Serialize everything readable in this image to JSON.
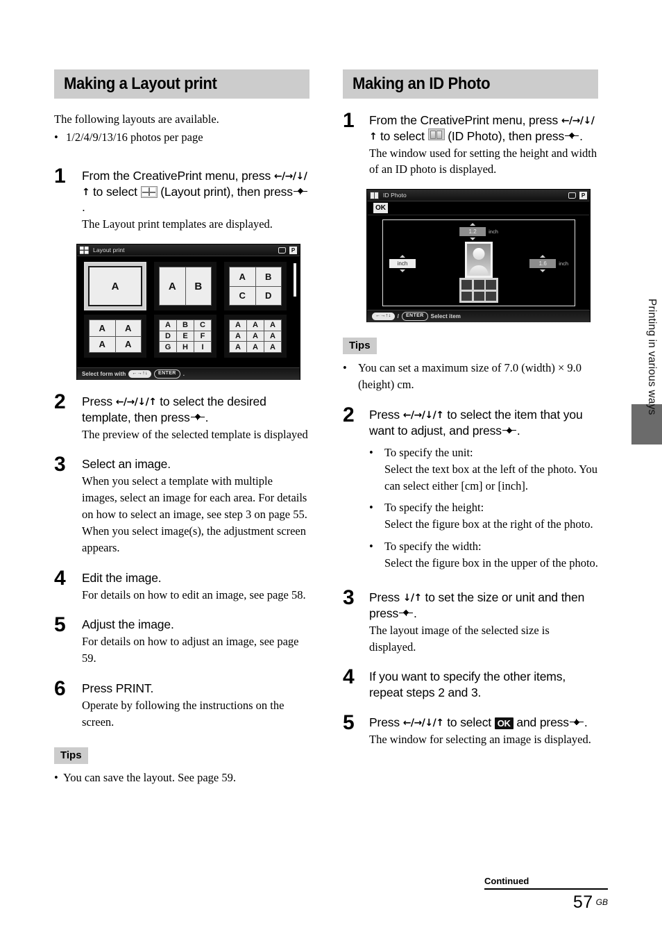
{
  "page": {
    "number": "57",
    "region_code": "GB",
    "continued_label": "Continued",
    "side_tab_label": "Printing in various ways",
    "side_tab_color": "#6b6b6b",
    "heading_band_color": "#cccccc"
  },
  "left_section": {
    "heading": "Making a Layout print",
    "intro": "The following layouts are available.",
    "intro_bullets": [
      "1/2/4/9/13/16 photos per page"
    ],
    "steps": [
      {
        "num": "1",
        "lead_a": "From the CreativePrint menu, press",
        "lead_arrows": "←/→/↓/↑",
        "lead_b": "to select",
        "icon": "layout-print-icon",
        "lead_c": "(Layout print), then press",
        "lead_d": ".",
        "sub": "The Layout print templates are displayed."
      },
      {
        "num": "2",
        "lead_a": "Press",
        "lead_arrows": "←/→/↓/↑",
        "lead_b": "to select the desired template, then press",
        "lead_d": ".",
        "sub": "The preview of the selected template is displayed"
      },
      {
        "num": "3",
        "lead_a": "Select an image.",
        "sub": "When you select a template with multiple images, select an image for each area. For details on how to select an image, see step 3 on page 55. When you select image(s), the adjustment screen appears."
      },
      {
        "num": "4",
        "lead_a": "Edit the image.",
        "sub": "For details on how to edit an image, see page 58."
      },
      {
        "num": "5",
        "lead_a": "Adjust the image.",
        "sub": "For details on how to adjust an image, see page 59."
      },
      {
        "num": "6",
        "lead_a": "Press PRINT.",
        "sub": "Operate by following the instructions on the screen."
      }
    ],
    "tips": {
      "label": "Tips",
      "items": [
        "You can save the layout. See page 59."
      ]
    },
    "screenshot": {
      "title": "Layout print",
      "title_icon": "layout-grid-icon",
      "status_icons": [
        "display-icon",
        "p-icon"
      ],
      "p_icon_label": "P",
      "bottom_hint_prefix": "Select form with",
      "bottom_hint_arrows": "←→↑↓",
      "bottom_hint_enter": "ENTER",
      "bottom_hint_suffix": ".",
      "templates": [
        {
          "name": "1-up",
          "cols": 1,
          "rows": 1,
          "labels": [
            "A"
          ],
          "selected": true,
          "size": "lg"
        },
        {
          "name": "2-up",
          "cols": 2,
          "rows": 1,
          "labels": [
            "A",
            "B"
          ],
          "selected": false,
          "size": "lg"
        },
        {
          "name": "4-up-abcd",
          "cols": 2,
          "rows": 2,
          "labels": [
            "A",
            "B",
            "C",
            "D"
          ],
          "selected": false,
          "size": "md"
        },
        {
          "name": "4-up-aaaa",
          "cols": 2,
          "rows": 2,
          "labels": [
            "A",
            "A",
            "A",
            "A"
          ],
          "selected": false,
          "size": "md"
        },
        {
          "name": "9-up-abcdefghi",
          "cols": 3,
          "rows": 3,
          "labels": [
            "A",
            "B",
            "C",
            "D",
            "E",
            "F",
            "G",
            "H",
            "I"
          ],
          "selected": false,
          "size": "sm"
        },
        {
          "name": "9-up-aaaaaaaaa",
          "cols": 3,
          "rows": 3,
          "labels": [
            "A",
            "A",
            "A",
            "A",
            "A",
            "A",
            "A",
            "A",
            "A"
          ],
          "selected": false,
          "size": "sm"
        }
      ]
    }
  },
  "right_section": {
    "heading": "Making an ID Photo",
    "steps": [
      {
        "num": "1",
        "lead_a": "From the CreativePrint menu, press",
        "lead_arrows": "←/→/↓/↑",
        "lead_b": "to select",
        "icon": "id-photo-icon",
        "lead_c": "(ID Photo), then press",
        "lead_d": ".",
        "sub": "The window used for setting the height and width of an ID photo is displayed."
      },
      {
        "num": "2",
        "lead_a": "Press",
        "lead_arrows": "←/→/↓/↑",
        "lead_b": "to select the item that you want to adjust, and press",
        "lead_d": ".",
        "bullets": [
          {
            "title": "To specify the unit:",
            "text": "Select the text box at the left of the photo. You can select either [cm] or [inch]."
          },
          {
            "title": "To specify the height:",
            "text": "Select the figure box at the right of the photo."
          },
          {
            "title": "To specify the width:",
            "text": "Select the figure box in the upper of the photo."
          }
        ]
      },
      {
        "num": "3",
        "lead_a": "Press",
        "lead_arrows": "↓/↑",
        "lead_b": "to set the size or unit and then press",
        "lead_d": ".",
        "sub": "The layout image of the selected size is displayed."
      },
      {
        "num": "4",
        "lead_a": "If you want to specify the other items, repeat steps 2 and 3."
      },
      {
        "num": "5",
        "lead_a": "Press",
        "lead_arrows": "←/→/↓/↑",
        "lead_b": "to select",
        "ok_badge": "OK",
        "lead_c": "and press",
        "lead_d": ".",
        "sub": "The window for selecting an image is displayed."
      }
    ],
    "tips": {
      "label": "Tips",
      "items": [
        "You can set a maximum size of 7.0 (width) × 9.0 (height) cm."
      ]
    },
    "screenshot": {
      "title": "ID Photo",
      "title_icon": "id-photo-grid-icon",
      "status_icons": [
        "display-icon",
        "p-icon"
      ],
      "p_icon_label": "P",
      "ok_button": "OK",
      "width_value": "1.2",
      "width_unit": "inch",
      "height_value": "1.6",
      "height_unit": "inch",
      "unit_box_value": "inch",
      "bottom_hint_arrows": "←→↑↓",
      "bottom_hint_sep": "/",
      "bottom_hint_enter": "ENTER",
      "bottom_hint_text": "Select  item"
    }
  }
}
